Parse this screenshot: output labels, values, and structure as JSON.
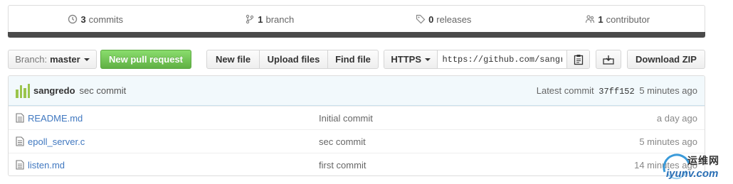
{
  "stats": {
    "commits_count": "3",
    "commits_label": "commits",
    "branch_count": "1",
    "branch_label": "branch",
    "releases_count": "0",
    "releases_label": "releases",
    "contributor_count": "1",
    "contributor_label": "contributor"
  },
  "toolbar": {
    "branch_label": "Branch:",
    "branch_value": "master",
    "new_pr_label": "New pull request",
    "new_file_label": "New file",
    "upload_label": "Upload files",
    "find_file_label": "Find file",
    "clone_protocol": "HTTPS",
    "clone_url": "https://github.com/sangredo",
    "download_zip_label": "Download ZIP"
  },
  "commit_tease": {
    "author": "sangredo",
    "message": "sec commit",
    "latest_label": "Latest commit",
    "sha": "37ff152",
    "age": "5 minutes ago"
  },
  "files": [
    {
      "name": "README.md",
      "message": "Initial commit",
      "age": "a day ago"
    },
    {
      "name": "epoll_server.c",
      "message": "sec commit",
      "age": "5 minutes ago"
    },
    {
      "name": "listen.md",
      "message": "first commit",
      "age": "14 minutes ago"
    }
  ],
  "watermark": {
    "cn": "运维网",
    "en": "iyunv.com"
  },
  "colors": {
    "accent_link": "#4078c0",
    "pr_green": "#60b044",
    "tease_bg": "#f2f9fc"
  }
}
